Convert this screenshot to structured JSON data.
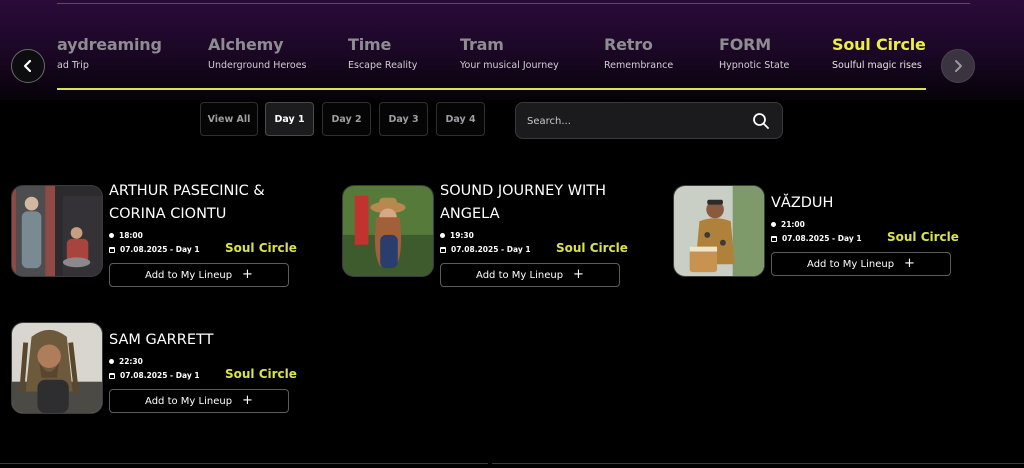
{
  "stages": [
    {
      "name": "aydreaming",
      "subtitle": "ad Trip",
      "active": false
    },
    {
      "name": "Alchemy",
      "subtitle": "Underground Heroes",
      "active": false
    },
    {
      "name": "Time",
      "subtitle": "Escape Reality",
      "active": false
    },
    {
      "name": "Tram",
      "subtitle": "Your musical Journey",
      "active": false
    },
    {
      "name": "Retro",
      "subtitle": "Remembrance",
      "active": false
    },
    {
      "name": "FORM",
      "subtitle": "Hypnotic State",
      "active": false
    },
    {
      "name": "Soul Circle",
      "subtitle": "Soulful magic rises",
      "active": true
    }
  ],
  "days": [
    {
      "label": "View All",
      "active": false
    },
    {
      "label": "Day 1",
      "active": true
    },
    {
      "label": "Day 2",
      "active": false
    },
    {
      "label": "Day 3",
      "active": false
    },
    {
      "label": "Day 4",
      "active": false
    }
  ],
  "search": {
    "placeholder": "Search..."
  },
  "artists": [
    {
      "name": "ARTHUR PASECINIC & CORINA CIONTU",
      "time": "18:00",
      "date": "07.08.2025 - Day 1",
      "stage": "Soul Circle",
      "button": "Add to My Lineup",
      "plus": "+"
    },
    {
      "name": "SOUND JOURNEY WITH ANGELA",
      "time": "19:30",
      "date": "07.08.2025 - Day 1",
      "stage": "Soul Circle",
      "button": "Add to My Lineup",
      "plus": "+"
    },
    {
      "name": "VĂZDUH",
      "time": "21:00",
      "date": "07.08.2025 - Day 1",
      "stage": "Soul Circle",
      "button": "Add to My Lineup",
      "plus": "+"
    },
    {
      "name": "SAM GARRETT",
      "time": "22:30",
      "date": "07.08.2025 - Day 1",
      "stage": "Soul Circle",
      "button": "Add to My Lineup",
      "plus": "+"
    }
  ],
  "colors": {
    "accent": "#dbe34a",
    "background": "#000000",
    "header": "#2b0a3a"
  },
  "icons": {
    "prev": "chevron-left-icon",
    "next": "chevron-right-icon",
    "search": "search-icon",
    "time": "clock-icon",
    "date": "calendar-icon",
    "add": "plus-icon"
  }
}
